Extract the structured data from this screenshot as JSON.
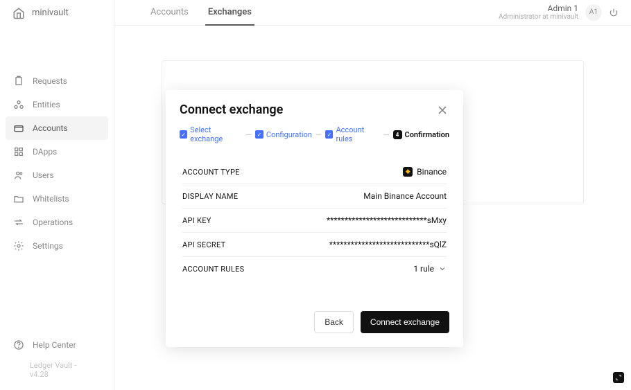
{
  "brand": {
    "name": "minivault"
  },
  "sidebar": {
    "items": [
      {
        "label": "Requests"
      },
      {
        "label": "Entities"
      },
      {
        "label": "Accounts"
      },
      {
        "label": "DApps"
      },
      {
        "label": "Users"
      },
      {
        "label": "Whitelists"
      },
      {
        "label": "Operations"
      },
      {
        "label": "Settings"
      }
    ],
    "help_label": "Help Center",
    "version": "Ledger Vault - v4.28"
  },
  "tabs": {
    "accounts": "Accounts",
    "exchanges": "Exchanges"
  },
  "user": {
    "name": "Admin 1",
    "role": "Administrator at minivault",
    "initials": "A1"
  },
  "modal": {
    "title": "Connect exchange",
    "steps": {
      "select": "Select exchange",
      "config": "Configuration",
      "rules": "Account rules",
      "confirm_num": "4",
      "confirm": "Confirmation"
    },
    "rows": {
      "account_type_label": "ACCOUNT TYPE",
      "account_type_value": "Binance",
      "display_name_label": "DISPLAY NAME",
      "display_name_value": "Main Binance Account",
      "api_key_label": "API KEY",
      "api_key_value": "****************************sMxy",
      "api_secret_label": "API SECRET",
      "api_secret_value": "****************************sQlZ",
      "account_rules_label": "ACCOUNT RULES",
      "account_rules_value": "1 rule"
    },
    "buttons": {
      "back": "Back",
      "connect": "Connect exchange"
    }
  }
}
